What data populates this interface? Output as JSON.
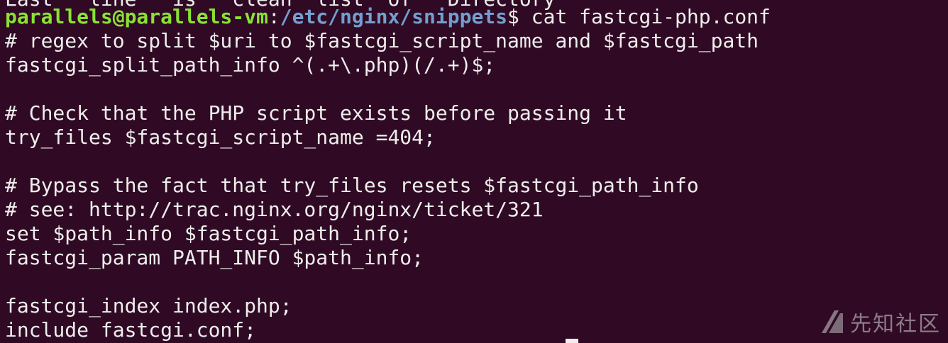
{
  "terminal": {
    "top_partial_line": "Last   line   is   clean  list  of   Directory",
    "prompt": {
      "user_host": "parallels@parallels-vm",
      "separator": ":",
      "path": "/etc/nginx/snippets",
      "symbol": "$",
      "command": " cat fastcgi-php.conf"
    },
    "lines": [
      "# regex to split $uri to $fastcgi_script_name and $fastcgi_path",
      "fastcgi_split_path_info ^(.+\\.php)(/.+)$;",
      "",
      "# Check that the PHP script exists before passing it",
      "try_files $fastcgi_script_name =404;",
      "",
      "# Bypass the fact that try_files resets $fastcgi_path_info",
      "# see: http://trac.nginx.org/nginx/ticket/321",
      "set $path_info $fastcgi_path_info;",
      "fastcgi_param PATH_INFO $path_info;",
      "",
      "fastcgi_index index.php;",
      "include fastcgi.conf;"
    ],
    "colors": {
      "background": "#300a24",
      "foreground": "#eeeeec",
      "prompt_user": "#8ae234",
      "prompt_path": "#729fcf"
    }
  },
  "watermark": {
    "icon": "xianzhi-logo-icon",
    "text": "先知社区"
  }
}
